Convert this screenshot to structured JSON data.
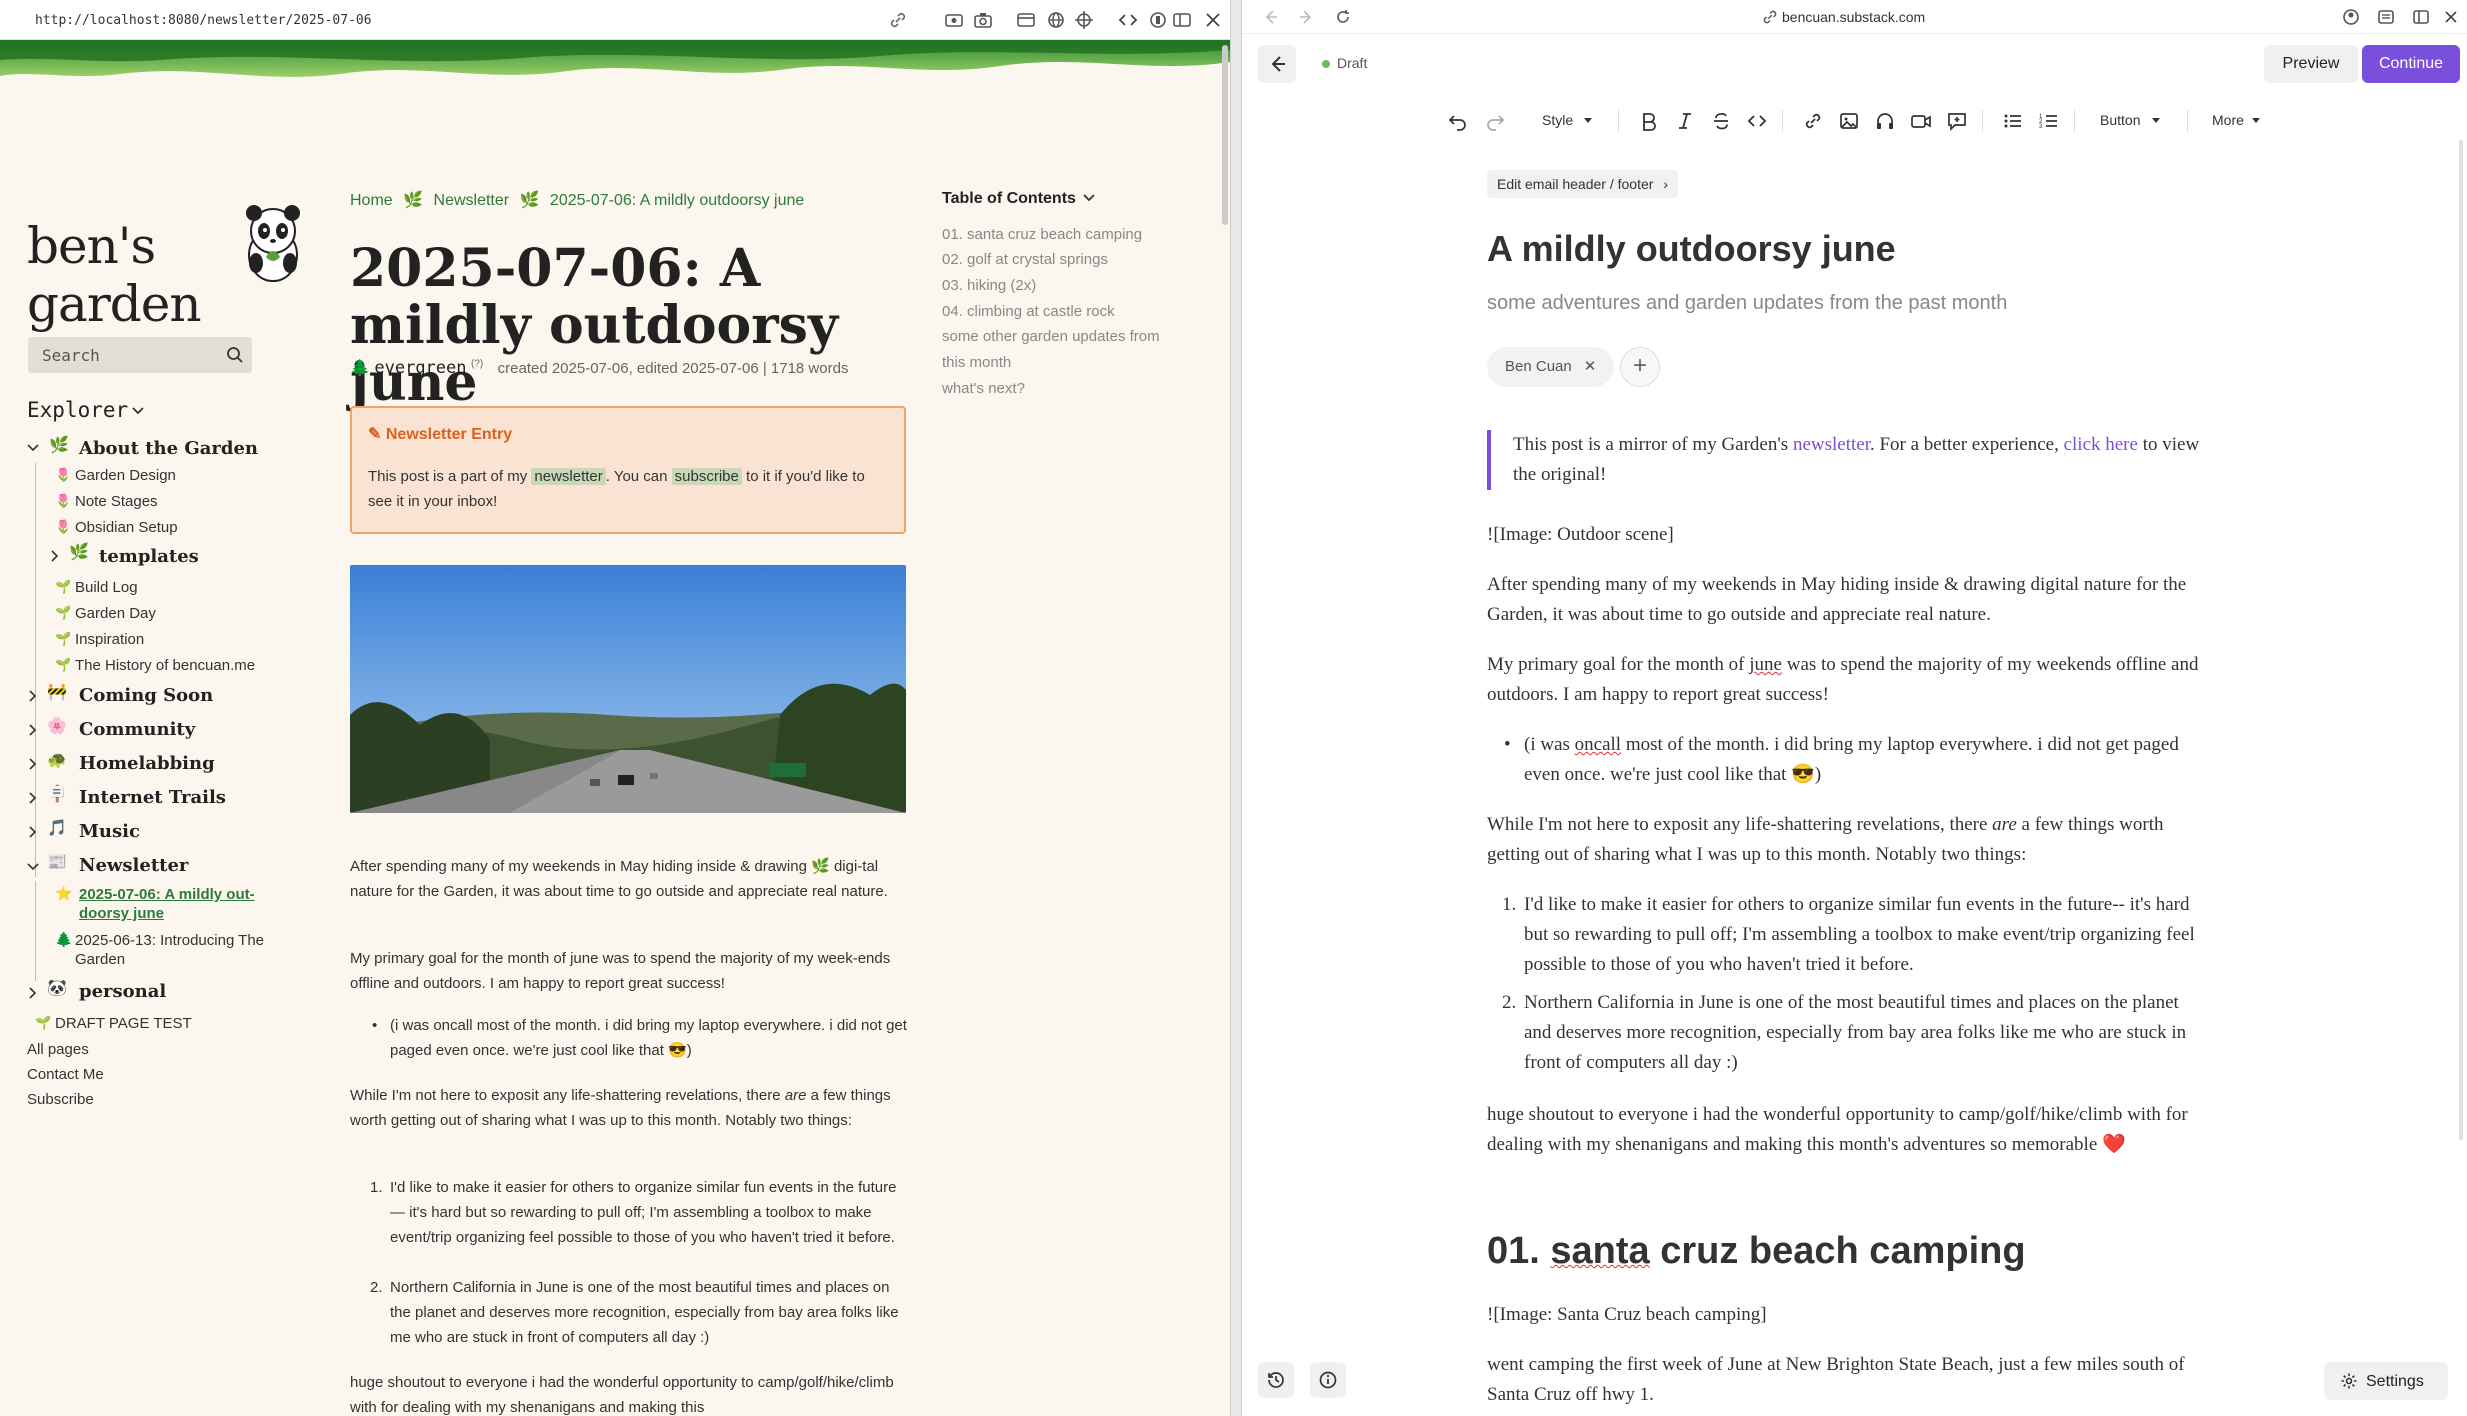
{
  "left": {
    "url": "http://localhost:8080/newsletter/2025-07-06",
    "site_title": "ben's garden",
    "search_placeholder": "Search",
    "explorer_title": "Explorer",
    "tree": [
      {
        "label": "About the Garden",
        "kind": "top",
        "open": true
      },
      {
        "label": "Garden Design",
        "kind": "sub"
      },
      {
        "label": "Note Stages",
        "kind": "sub"
      },
      {
        "label": "Obsidian Setup",
        "kind": "sub"
      },
      {
        "label": "templates",
        "kind": "sub-folder"
      },
      {
        "label": "Build Log",
        "kind": "sub"
      },
      {
        "label": "Garden Day",
        "kind": "sub"
      },
      {
        "label": "Inspiration",
        "kind": "sub"
      },
      {
        "label": "The History of bencuan.me",
        "kind": "sub"
      },
      {
        "label": "Coming Soon",
        "kind": "top"
      },
      {
        "label": "Community",
        "kind": "top"
      },
      {
        "label": "Homelabbing",
        "kind": "top"
      },
      {
        "label": "Internet Trails",
        "kind": "top"
      },
      {
        "label": "Music",
        "kind": "top"
      },
      {
        "label": "Newsletter",
        "kind": "top",
        "open": true
      },
      {
        "label": "2025-07-06: A mildly out-doorsy june",
        "kind": "active"
      },
      {
        "label": "2025-06-13: Introducing The Garden",
        "kind": "sub"
      },
      {
        "label": "personal",
        "kind": "top"
      },
      {
        "label": "DRAFT PAGE TEST",
        "kind": "link"
      },
      {
        "label": "All pages",
        "kind": "plain"
      },
      {
        "label": "Contact Me",
        "kind": "plain"
      },
      {
        "label": "Subscribe",
        "kind": "plain"
      }
    ],
    "breadcrumb": [
      "Home",
      "Newsletter",
      "2025-07-06: A mildly outdoorsy june"
    ],
    "article_title": "2025-07-06: A mildly outdoorsy june",
    "stage": "evergreen",
    "stage_sup": "(?)",
    "meta": "created 2025-07-06, edited 2025-07-06 | 1718 words",
    "callout_title": "Newsletter Entry",
    "callout_pre": "This post is a part of my ",
    "callout_link1": "newsletter",
    "callout_mid": ". You can ",
    "callout_link2": "subscribe",
    "callout_post": " to it if you'd like to see it in your inbox!",
    "p1a": "After spending many of my weekends in May hiding inside & drawing",
    "p1b": "digi-tal nature for the Garden, it was about time to go outside and appreciate real nature.",
    "p2": "My primary goal for the month of june was to spend the majority of my week-ends offline and outdoors. I am happy to report great success!",
    "li1": "(i was oncall most of the month. i did bring my laptop everywhere. i did not get paged even once. we're just cool like that 😎)",
    "p3a": "While I'm not here to exposit any life-shattering revelations, there ",
    "p3em": "are",
    "p3b": " a few things worth getting out of sharing what I was up to this month. Notably two things:",
    "ol1": "I'd like to make it easier for others to organize similar fun events in the future— it's hard but so rewarding to pull off; I'm assembling a toolbox to make event/trip organizing feel possible to those of you who haven't tried it before.",
    "ol2": "Northern California in June is one of the most beautiful times and places on the planet and deserves more recognition, especially from bay area folks like me who are stuck in front of computers all day :)",
    "p4": "huge shoutout to everyone i had the wonderful opportunity to camp/golf/hike/climb with for dealing with my shenanigans and making this",
    "toc_title": "Table of Contents",
    "toc": [
      "01. santa cruz beach camping",
      "02. golf at crystal springs",
      "03. hiking (2x)",
      "04. climbing at castle rock",
      "some other garden updates from",
      "this month",
      "what's next?"
    ]
  },
  "right": {
    "url": "bencuan.substack.com",
    "status": "Draft",
    "preview": "Preview",
    "continue": "Continue",
    "style_label": "Style",
    "button_label": "Button",
    "more_label": "More",
    "edit_header": "Edit email header / footer",
    "title": "A mildly outdoorsy june",
    "subtitle": "some adventures and garden updates from the past month",
    "author": "Ben Cuan",
    "add_author": "+",
    "quote_pre": "This post is a mirror of my Garden's ",
    "quote_link1": "newsletter",
    "quote_mid": ". For a better experience, ",
    "quote_link2": "click here",
    "quote_post": " to view the original!",
    "img1": "![Image: Outdoor scene]",
    "p1": "After spending many of my weekends in May hiding inside & drawing digital nature for the Garden, it was about time to go outside and appreciate real nature.",
    "p2a": "My primary goal for the month of ",
    "p2u": "june",
    "p2b": " was to spend the majority of my weekends offline and outdoors. I am happy to report great success!",
    "li1a": "(i was ",
    "li1u": "oncall",
    "li1b": " most of the month. i did bring my laptop everywhere. i did not get paged even once. we're just cool like that 😎)",
    "p3a": "While I'm not here to exposit any life-shattering revelations, there ",
    "p3em": "are",
    "p3b": " a few things worth getting out of sharing what I was up to this month. Notably two things:",
    "ol1": "I'd like to make it easier for others to organize similar fun events in the future-- it's hard but so rewarding to pull off; I'm assembling a toolbox to make event/trip organizing feel possible to those of you who haven't tried it before.",
    "ol2": "Northern California in June is one of the most beautiful times and places on the planet and deserves more recognition, especially from bay area folks like me who are stuck in front of computers all day :)",
    "p4": "huge shoutout to everyone i had the wonderful opportunity to camp/golf/hike/climb with for dealing with my shenanigans and making this month's adventures so memorable ❤️",
    "h2_num": "01. ",
    "h2_u": "santa",
    "h2_rest": " cruz beach camping",
    "img2": "![Image: Santa Cruz beach camping]",
    "p5": "went camping the first week of June at New Brighton State Beach, just a few miles south of Santa Cruz off hwy 1.",
    "settings": "Settings",
    "accent": "#7a4fdb"
  }
}
